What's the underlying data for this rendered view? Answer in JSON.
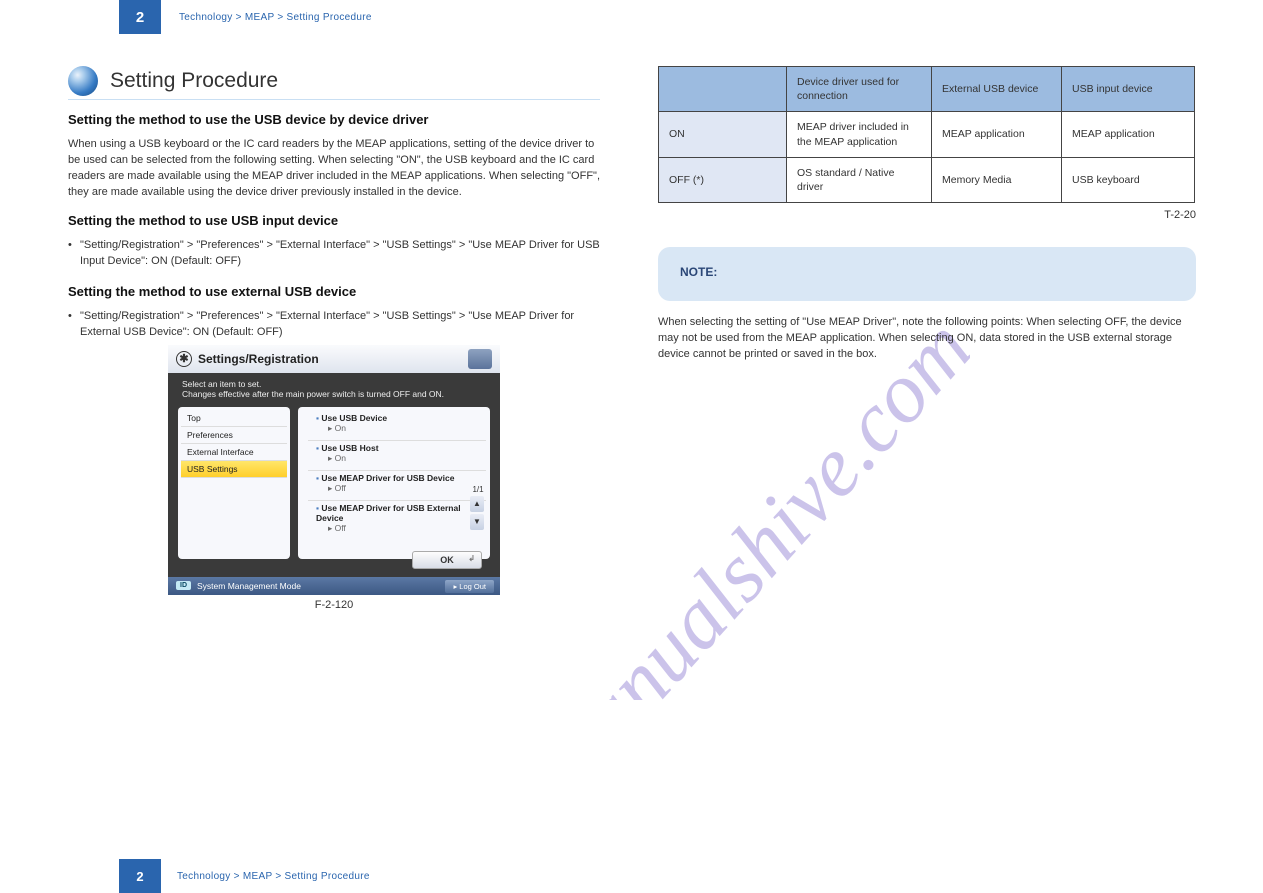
{
  "chapter": {
    "num": "2",
    "title": "Technology > MEAP > Setting Procedure"
  },
  "section_title": "Setting Procedure",
  "left": {
    "h1": "Setting the method to use the USB device by device driver",
    "p1": "When using a USB keyboard or the IC card readers by the MEAP applications, setting of the device driver to be used can be selected from the following setting. When selecting \"ON\", the USB keyboard and the IC card readers are made available using the MEAP driver included in the MEAP applications. When selecting \"OFF\", they are made available using the device driver previously installed in the device.",
    "h2": "Setting the method to use USB input device",
    "li1": "\"Setting/Registration\" > \"Preferences\" > \"External Interface\" > \"USB Settings\" > \"Use MEAP Driver for USB Input Device\": ON (Default: OFF)",
    "h3": "Setting the method to use external USB device",
    "li2": "\"Setting/Registration\" > \"Preferences\" > \"External Interface\" > \"USB Settings\" > \"Use MEAP Driver for External USB Device\": ON (Default: OFF)",
    "figcap": "F-2-120"
  },
  "screenshot": {
    "title": "Settings/Registration",
    "prompt_line1": "Select an item to set.",
    "prompt_line2": "Changes effective after the main power switch is turned OFF and ON.",
    "sidebar": {
      "items": [
        "Top",
        "Preferences",
        "External Interface",
        "USB Settings"
      ],
      "selected_index": 3
    },
    "usb": {
      "items": [
        {
          "label": "Use USB Device",
          "value": "On"
        },
        {
          "label": "Use USB Host",
          "value": "On"
        },
        {
          "label": "Use MEAP Driver for USB Device",
          "value": "Off"
        },
        {
          "label": "Use MEAP Driver for USB External Device",
          "value": "Off"
        }
      ]
    },
    "pager": "1/1",
    "ok": "OK",
    "status": "System Management Mode",
    "id_badge": "ID",
    "logout": "▸ Log Out"
  },
  "table_label": "T-2-20",
  "table": {
    "headers": [
      "",
      "Device driver used for connection",
      "External USB device",
      "USB input device"
    ],
    "rows": [
      {
        "h": "ON",
        "c1": "MEAP driver included in the MEAP application",
        "c2": "MEAP application",
        "c3": "MEAP application"
      },
      {
        "h": "OFF (*)",
        "c1": "OS standard / Native driver",
        "c2": "Memory Media",
        "c3": "USB keyboard"
      }
    ]
  },
  "note": {
    "title": "NOTE:",
    "p": "When selecting the setting of \"Use MEAP Driver\", note the following points: When selecting OFF, the device may not be used from the MEAP application. When selecting ON, data stored in the USB external storage device cannot be printed or saved in the box."
  },
  "footer": {
    "page": "2",
    "title": "Technology > MEAP > Setting Procedure"
  },
  "watermark": "manualshive.com"
}
